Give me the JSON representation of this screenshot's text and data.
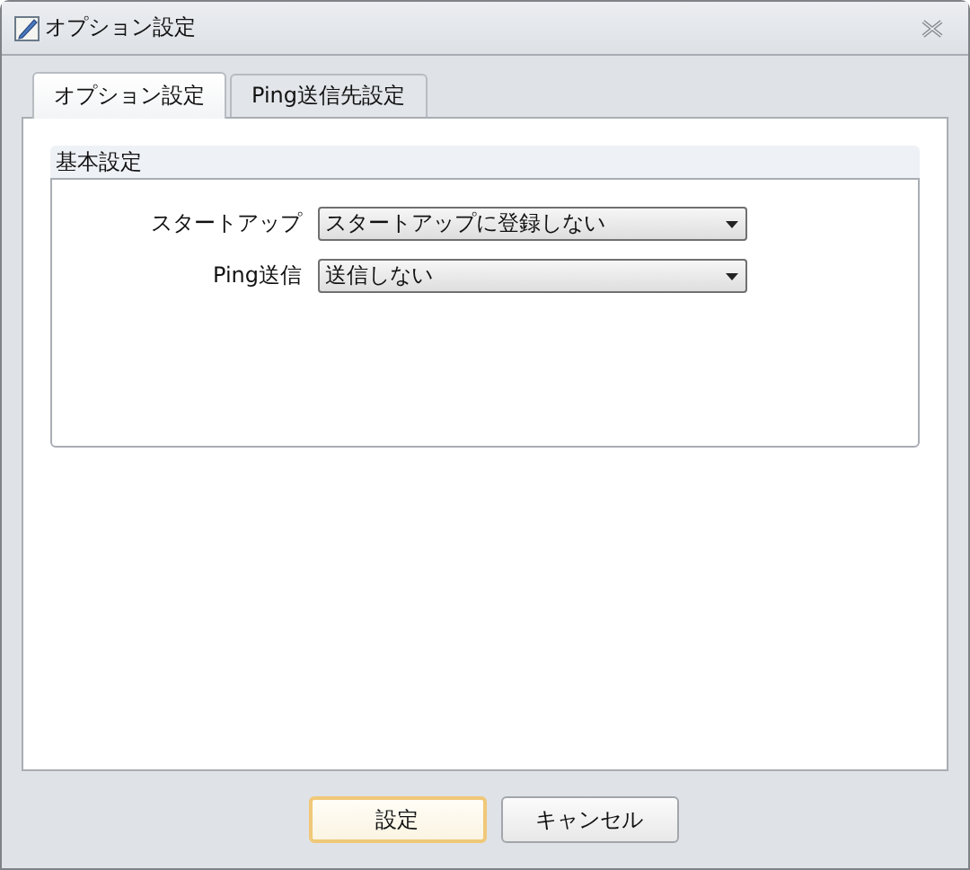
{
  "window": {
    "title": "オプション設定"
  },
  "tabs": [
    {
      "label": "オプション設定",
      "selected": true
    },
    {
      "label": "Ping送信先設定",
      "selected": false
    }
  ],
  "group": {
    "title": "基本設定"
  },
  "fields": [
    {
      "label": "スタートアップ",
      "value": "スタートアップに登録しない"
    },
    {
      "label": "Ping送信",
      "value": "送信しない"
    }
  ],
  "buttons": [
    {
      "label": "設定",
      "default": true
    },
    {
      "label": "キャンセル",
      "default": false
    }
  ]
}
